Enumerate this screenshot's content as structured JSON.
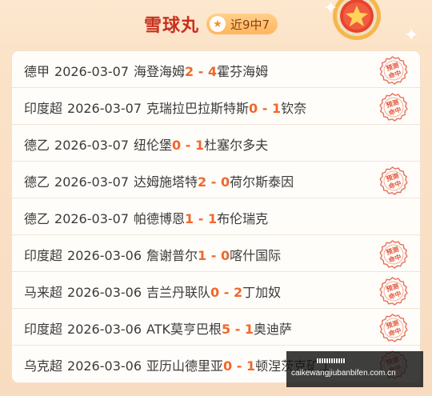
{
  "header": {
    "title": "雪球丸",
    "streak": "近9中7",
    "accent_color": "#c8301c",
    "badge_color": "#ffb65c",
    "medal_icon": "star-medal-icon"
  },
  "stamp": {
    "text_top": "预测",
    "text_bottom": "命中",
    "color": "#e2583d"
  },
  "rows": [
    {
      "league": "德甲",
      "date": "2026-03-07",
      "home": "海登海姆",
      "home_score": "2",
      "away_score": "4",
      "away": "霍芬海姆",
      "hit": true
    },
    {
      "league": "印度超",
      "date": "2026-03-07",
      "home": "克瑞拉巴拉斯特斯",
      "home_score": "0",
      "away_score": "1",
      "away": "钦奈",
      "hit": true
    },
    {
      "league": "德乙",
      "date": "2026-03-07",
      "home": "纽伦堡",
      "home_score": "0",
      "away_score": "1",
      "away": "杜塞尔多夫",
      "hit": false
    },
    {
      "league": "德乙",
      "date": "2026-03-07",
      "home": "达姆施塔特",
      "home_score": "2",
      "away_score": "0",
      "away": "荷尔斯泰因",
      "hit": true
    },
    {
      "league": "德乙",
      "date": "2026-03-07",
      "home": "帕德博恩",
      "home_score": "1",
      "away_score": "1",
      "away": "布伦瑞克",
      "hit": false
    },
    {
      "league": "印度超",
      "date": "2026-03-06",
      "home": "詹谢普尔",
      "home_score": "1",
      "away_score": "0",
      "away": "喀什国际",
      "hit": true
    },
    {
      "league": "马来超",
      "date": "2026-03-06",
      "home": "吉兰丹联队",
      "home_score": "0",
      "away_score": "2",
      "away": "丁加奴",
      "hit": true
    },
    {
      "league": "印度超",
      "date": "2026-03-06",
      "home": "ATK莫亨巴根",
      "home_score": "5",
      "away_score": "1",
      "away": "奥迪萨",
      "hit": true
    },
    {
      "league": "乌克超",
      "date": "2026-03-06",
      "home": "亚历山德里亚",
      "home_score": "0",
      "away_score": "1",
      "away": "顿涅茨克矿工",
      "hit": true
    }
  ],
  "watermark": {
    "domain": "caikewangjiubanbifen.com.cn"
  }
}
